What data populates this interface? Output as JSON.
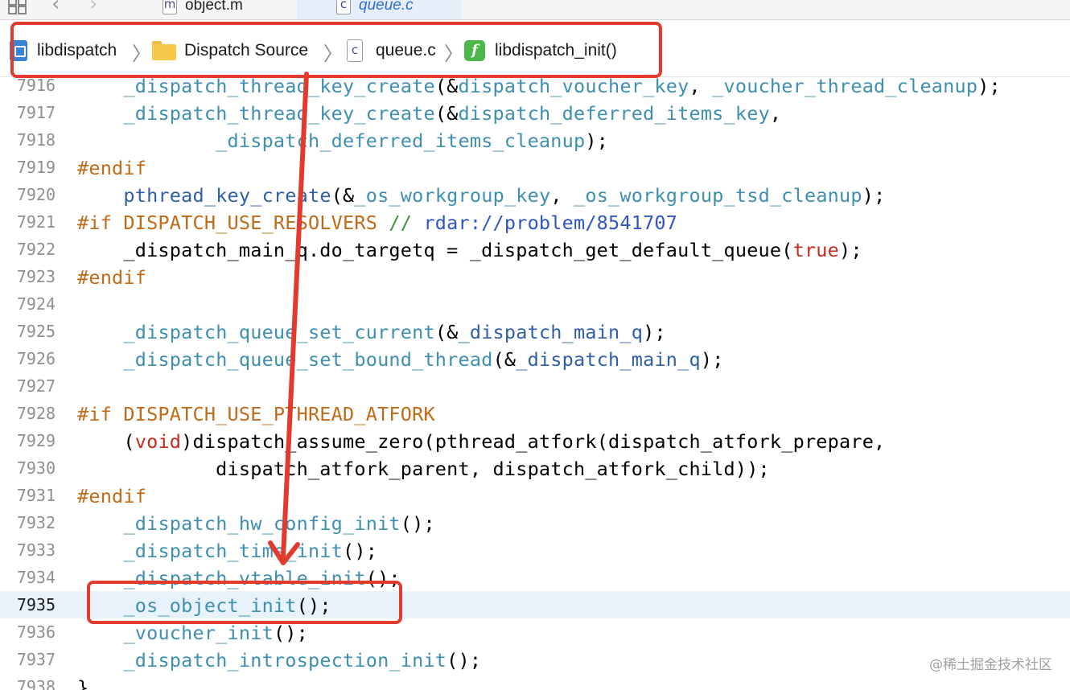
{
  "tabs": [
    {
      "icon": "m",
      "label": "object.m",
      "active": false
    },
    {
      "icon": "c",
      "label": "queue.c",
      "active": true
    }
  ],
  "breadcrumb": {
    "project": "libdispatch",
    "group": "Dispatch Source",
    "file_icon": "c",
    "file": "queue.c",
    "function_icon": "f",
    "function": "libdispatch_init()",
    "separator": "〉"
  },
  "editor": {
    "current_line": "7935",
    "lines": [
      {
        "no": "7916",
        "segs": [
          {
            "t": "    ",
            "k": "p"
          },
          {
            "t": "_dispatch_thread_key_create",
            "k": "fn"
          },
          {
            "t": "(&",
            "k": "p"
          },
          {
            "t": "dispatch_voucher_key",
            "k": "fn"
          },
          {
            "t": ", ",
            "k": "p"
          },
          {
            "t": "_voucher_thread_cleanup",
            "k": "fn"
          },
          {
            "t": ");",
            "k": "p"
          }
        ]
      },
      {
        "no": "7917",
        "segs": [
          {
            "t": "    ",
            "k": "p"
          },
          {
            "t": "_dispatch_thread_key_create",
            "k": "fn"
          },
          {
            "t": "(&",
            "k": "p"
          },
          {
            "t": "dispatch_deferred_items_key",
            "k": "fn"
          },
          {
            "t": ",",
            "k": "p"
          }
        ]
      },
      {
        "no": "7918",
        "segs": [
          {
            "t": "            ",
            "k": "p"
          },
          {
            "t": "_dispatch_deferred_items_cleanup",
            "k": "fn"
          },
          {
            "t": ");",
            "k": "p"
          }
        ]
      },
      {
        "no": "7919",
        "segs": [
          {
            "t": "#endif",
            "k": "pp"
          }
        ]
      },
      {
        "no": "7920",
        "segs": [
          {
            "t": "    ",
            "k": "p"
          },
          {
            "t": "pthread_key_create",
            "k": "fn2"
          },
          {
            "t": "(&",
            "k": "p"
          },
          {
            "t": "_os_workgroup_key",
            "k": "fn"
          },
          {
            "t": ", ",
            "k": "p"
          },
          {
            "t": "_os_workgroup_tsd_cleanup",
            "k": "fn"
          },
          {
            "t": ");",
            "k": "p"
          }
        ]
      },
      {
        "no": "7921",
        "segs": [
          {
            "t": "#if DISPATCH_USE_RESOLVERS ",
            "k": "pp"
          },
          {
            "t": "// ",
            "k": "cm"
          },
          {
            "t": "rdar://problem/8541707",
            "k": "url"
          }
        ]
      },
      {
        "no": "7922",
        "segs": [
          {
            "t": "    _dispatch_main_q.do_targetq = _dispatch_get_default_queue(",
            "k": "p"
          },
          {
            "t": "true",
            "k": "kw"
          },
          {
            "t": ");",
            "k": "p"
          }
        ]
      },
      {
        "no": "7923",
        "segs": [
          {
            "t": "#endif",
            "k": "pp"
          }
        ]
      },
      {
        "no": "7924",
        "segs": []
      },
      {
        "no": "7925",
        "segs": [
          {
            "t": "    ",
            "k": "p"
          },
          {
            "t": "_dispatch_queue_set_current",
            "k": "fn"
          },
          {
            "t": "(&",
            "k": "p"
          },
          {
            "t": "_dispatch_main_q",
            "k": "fn2"
          },
          {
            "t": ");",
            "k": "p"
          }
        ]
      },
      {
        "no": "7926",
        "segs": [
          {
            "t": "    ",
            "k": "p"
          },
          {
            "t": "_dispatch_queue_set_bound_thread",
            "k": "fn"
          },
          {
            "t": "(&",
            "k": "p"
          },
          {
            "t": "_dispatch_main_q",
            "k": "fn2"
          },
          {
            "t": ");",
            "k": "p"
          }
        ]
      },
      {
        "no": "7927",
        "segs": []
      },
      {
        "no": "7928",
        "segs": [
          {
            "t": "#if DISPATCH_USE_PTHREAD_ATFORK",
            "k": "pp"
          }
        ]
      },
      {
        "no": "7929",
        "segs": [
          {
            "t": "    (",
            "k": "p"
          },
          {
            "t": "void",
            "k": "kw"
          },
          {
            "t": ")dispatch_assume_zero(pthread_atfork(dispatch_atfork_prepare,",
            "k": "p"
          }
        ]
      },
      {
        "no": "7930",
        "segs": [
          {
            "t": "            dispatch_atfork_parent, dispatch_atfork_child));",
            "k": "p"
          }
        ]
      },
      {
        "no": "7931",
        "segs": [
          {
            "t": "#endif",
            "k": "pp"
          }
        ]
      },
      {
        "no": "7932",
        "segs": [
          {
            "t": "    ",
            "k": "p"
          },
          {
            "t": "_dispatch_hw_config_init",
            "k": "fn"
          },
          {
            "t": "();",
            "k": "p"
          }
        ]
      },
      {
        "no": "7933",
        "segs": [
          {
            "t": "    ",
            "k": "p"
          },
          {
            "t": "_dispatch_time_init",
            "k": "fn"
          },
          {
            "t": "();",
            "k": "p"
          }
        ]
      },
      {
        "no": "7934",
        "segs": [
          {
            "t": "    ",
            "k": "p"
          },
          {
            "t": "_dispatch_vtable_init",
            "k": "fn"
          },
          {
            "t": "();",
            "k": "p"
          }
        ]
      },
      {
        "no": "7935",
        "segs": [
          {
            "t": "    ",
            "k": "p"
          },
          {
            "t": "_os_object_init",
            "k": "fn"
          },
          {
            "t": "();",
            "k": "p"
          }
        ]
      },
      {
        "no": "7936",
        "segs": [
          {
            "t": "    ",
            "k": "p"
          },
          {
            "t": "_voucher_init",
            "k": "fn"
          },
          {
            "t": "();",
            "k": "p"
          }
        ]
      },
      {
        "no": "7937",
        "segs": [
          {
            "t": "    ",
            "k": "p"
          },
          {
            "t": "_dispatch_introspection_init",
            "k": "fn"
          },
          {
            "t": "();",
            "k": "p"
          }
        ]
      },
      {
        "no": "7938",
        "segs": [
          {
            "t": "}",
            "k": "p"
          }
        ]
      }
    ]
  },
  "colors": {
    "fn": "#3e8fb0",
    "fn2": "#2f5fa8",
    "pp": "#c06a17",
    "cm": "#3f8f3a",
    "url": "#2e55c6",
    "kw": "#c42b1c",
    "p": "#000000",
    "annotation": "#e23b2e"
  },
  "watermark": "@稀土掘金技术社区"
}
